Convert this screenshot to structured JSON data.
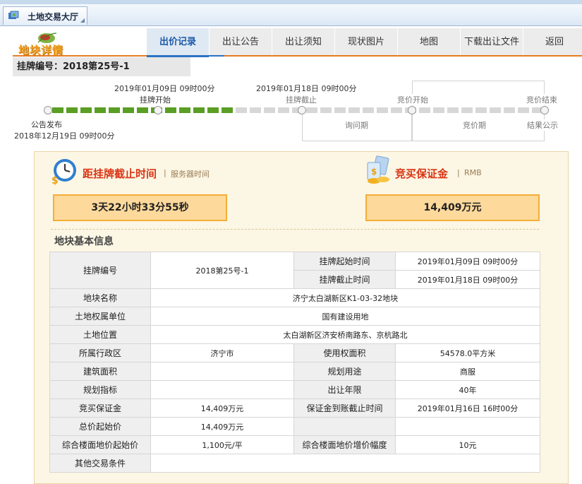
{
  "app_tab": {
    "title": "土地交易大厅",
    "icon": "land-hall-icon"
  },
  "logo": {
    "text": "地块详情"
  },
  "nav": [
    {
      "label": "出价记录",
      "active": true
    },
    {
      "label": "出让公告"
    },
    {
      "label": "出让须知"
    },
    {
      "label": "现状图片"
    },
    {
      "label": "地图"
    },
    {
      "label": "下载出让文件"
    },
    {
      "label": "返回"
    }
  ],
  "listing": {
    "label": "挂牌编号：2018第25号-1"
  },
  "timeline": {
    "listing_start_time": "2019年01月09日  09时00分",
    "listing_start_label": "挂牌开始",
    "listing_end_time": "2019年01月18日  09时00分",
    "listing_end_label": "挂牌截止",
    "bid_start_label": "竞价开始",
    "bid_end_label": "竞价结束",
    "announce_label": "公告发布",
    "announce_time": "2018年12月19日  09时00分",
    "inquiry_label": "询问期",
    "bidding_label": "竞价期",
    "result_label": "结果公示",
    "colors": {
      "progress": "#5a9e24",
      "pending": "#d7d7d7"
    }
  },
  "countdown": {
    "title": "距挂牌截止时间",
    "subtitle": "服务器时间",
    "value": "3天22小时33分55秒",
    "icon": "clock-icon"
  },
  "deposit": {
    "title": "竞买保证金",
    "subtitle": "RMB",
    "value": "14,409万元",
    "icon": "money-icon"
  },
  "info": {
    "title": "地块基本信息",
    "listing_no_label": "挂牌编号",
    "listing_no": "2018第25号-1",
    "start_label": "挂牌起始时间",
    "start": "2019年01月09日  09时00分",
    "end_label": "挂牌截止时间",
    "end": "2019年01月18日  09时00分",
    "name_label": "地块名称",
    "name": "济宁太白湖新区K1-03-32地块",
    "owner_label": "土地权属单位",
    "owner": "国有建设用地",
    "location_label": "土地位置",
    "location": "太白湖新区济安桥南路东、京杭路北",
    "district_label": "所属行政区",
    "district": "济宁市",
    "area_label": "使用权面积",
    "area": "54578.0平方米",
    "build_area_label": "建筑面积",
    "build_area": "",
    "usage_label": "规划用途",
    "usage": "商服",
    "index_label": "规划指标",
    "index": "",
    "term_label": "出让年限",
    "term": "40年",
    "deposit_label": "竞买保证金",
    "deposit": "14,409万元",
    "deposit_deadline_label": "保证金到账截止时间",
    "deposit_deadline": "2019年01月16日  16时00分",
    "total_price_label": "总价起始价",
    "total_price": "14,409万元",
    "floor_price_label": "综合楼面地价起始价",
    "floor_price": "1,100元/平",
    "floor_increment_label": "综合楼面地价增价幅度",
    "floor_increment": "10元",
    "other_label": "其他交易条件",
    "other": ""
  }
}
